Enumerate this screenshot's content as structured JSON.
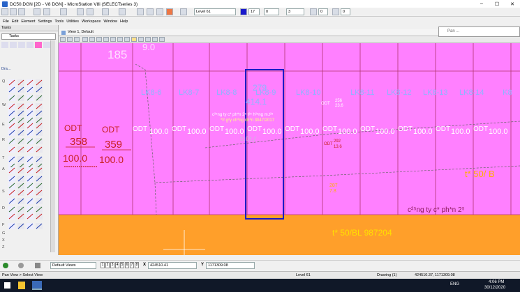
{
  "window": {
    "title": "DC50.DGN [2D - V8 DGN] - MicroStation V8i (SELECTseries 3)",
    "controls": [
      "–",
      "☐",
      "✕"
    ]
  },
  "menu": [
    "File",
    "Edit",
    "Element",
    "Settings",
    "Tools",
    "Utilities",
    "Workspace",
    "Window",
    "Help"
  ],
  "toolbar": {
    "level": "Level 61",
    "color_value": "17",
    "style_value": "0",
    "weight_value": "3",
    "trans_value": "0",
    "prio_value": "0"
  },
  "tasks": {
    "title": "Tasks",
    "dropdown": "Tasks",
    "drawing_group": "Dra...",
    "row_letters": [
      "Q",
      "W",
      "E",
      "R",
      "T",
      "A",
      "S",
      "D",
      "F",
      "G",
      "X",
      "Z",
      "C"
    ]
  },
  "view": {
    "title": "View 1, Default"
  },
  "panel": {
    "pinned_label": "Pan ..."
  },
  "drawing": {
    "labels_lk": [
      "LK8-6",
      "LK8-7",
      "LK8-8",
      "LK8-9",
      "LK8-10",
      "LK8-11",
      "LK8-12",
      "LK8-13",
      "LK8-14",
      "K8"
    ],
    "odt": [
      "ODT",
      "ODT",
      "ODT",
      "ODT",
      "ODT",
      "ODT",
      "ODT",
      "ODT",
      "ODT",
      "ODT",
      "ODT",
      "ODT",
      "ODT",
      "ODT"
    ],
    "parcel_nums": [
      "358",
      "359"
    ],
    "area_values": [
      "100.0",
      "100.0",
      "100.0",
      "100.0",
      "100.0",
      "100.0",
      "100.0",
      "100.0",
      "100.0",
      "100.0",
      "100.0",
      "100.0",
      "100.0",
      "100.0"
    ],
    "top_number": "185",
    "top_frag": "9.0",
    "blue_number": "279",
    "blue_area": "414.1",
    "small_odt_a": "ODT",
    "small_num_a": "256",
    "small_area_a": "23.6",
    "small_odt_b": "ODT",
    "small_num_b": "292",
    "small_area_b": "13.6",
    "note_line_1": "c²⁵ng ty c* ph*n 2⁵ t²⁵ h²⁵ng m.t²⁵",
    "note_line_2": "*t² g²y ch*ng nh*n 3047/2017",
    "gray_text": "ƀ.ẞt.ƒ",
    "bottom_text_a": "c²⁵ng ty c* ph*n 2⁵",
    "bottom_text_b": "t* 50/BL 987204",
    "right_text": "t* 50/ B",
    "yellow_small_a": "287",
    "yellow_small_b": "7.8"
  },
  "status_row": {
    "views_combo": "Default Views",
    "view_buttons": [
      "1",
      "2",
      "3",
      "4",
      "5",
      "6",
      "7",
      "8"
    ],
    "x_label": "X",
    "x_value": "424510.41",
    "y_label": "Y",
    "y_value": "1171309.08"
  },
  "statusbar": {
    "left": "Pan View > Select View",
    "level": "Level 61",
    "drawing": "Drawing (1)",
    "coords": "424510.37, 1171309.08"
  },
  "taskbar": {
    "lang": "ENG",
    "time": "4:06 PM",
    "date": "30/12/2020"
  },
  "colors": {
    "pink": "#ff80ff",
    "orange": "#ff9f2a",
    "grid_line": "#c0407a",
    "blue_frame": "#1a1ac8",
    "label_blue": "#8fb4ff",
    "text_red": "#c81e1e"
  }
}
